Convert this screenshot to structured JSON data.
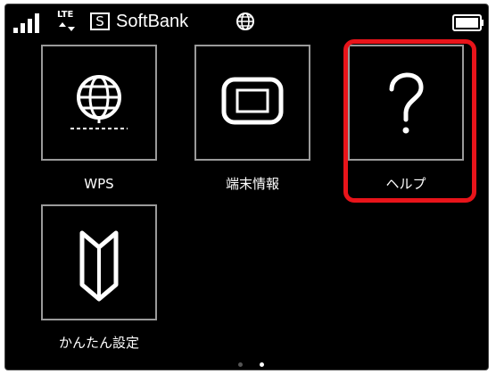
{
  "status_bar": {
    "network_type": "LTE",
    "sim_badge": "S",
    "carrier_name": "SoftBank",
    "signal_icon": "signal-bars-icon",
    "roaming_icon": "globe-icon",
    "battery_icon": "battery-full-icon"
  },
  "apps": [
    {
      "label": "WPS",
      "icon": "globe-icon"
    },
    {
      "label": "端末情報",
      "icon": "device-info-icon"
    },
    {
      "label": "ヘルプ",
      "icon": "question-mark-icon"
    },
    {
      "label": "かんたん設定",
      "icon": "beginner-mark-icon"
    }
  ],
  "pager": {
    "page_count": 2,
    "current_page": 2
  },
  "colors": {
    "highlight": "#e8141a",
    "background": "#000000",
    "tile_border": "#9a9a9a"
  }
}
